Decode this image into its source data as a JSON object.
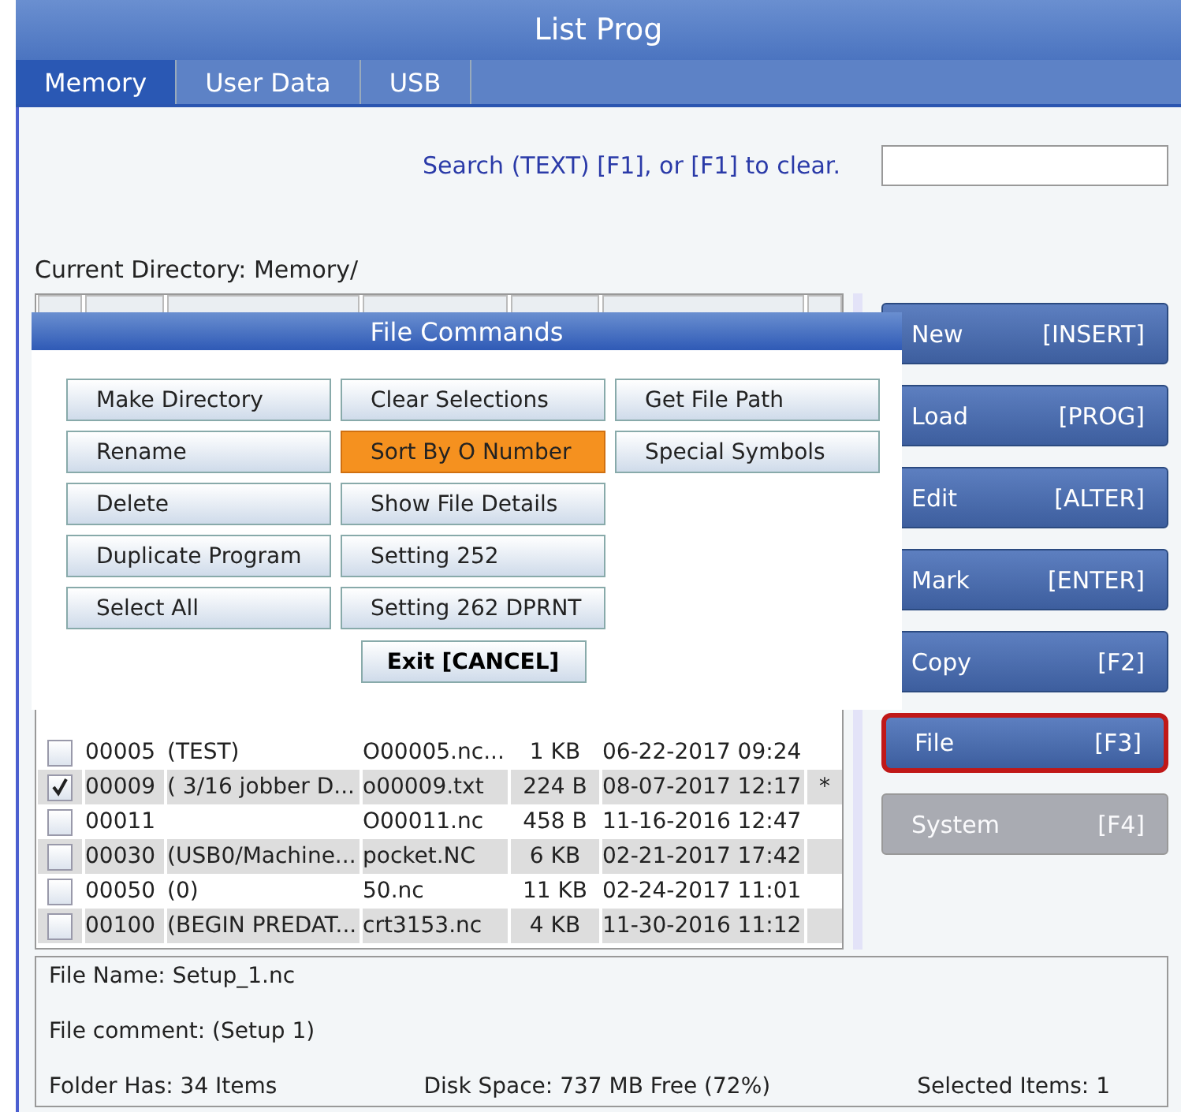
{
  "window": {
    "title": "List Prog"
  },
  "tabs": [
    {
      "label": "Memory",
      "selected": true
    },
    {
      "label": "User Data",
      "selected": false
    },
    {
      "label": "USB",
      "selected": false
    }
  ],
  "search": {
    "label": "Search (TEXT) [F1], or [F1] to clear."
  },
  "current_directory": "Current Directory: Memory/",
  "table": {
    "rows": [
      {
        "checked": false,
        "number": "00005",
        "comment": "(TEST)",
        "file_name": "O00005.nc...",
        "size": "1 KB",
        "last_modified": "06-22-2017 09:24"
      },
      {
        "checked": true,
        "number": "00009",
        "comment": "( 3/16 jobber D...",
        "file_name": "o00009.txt",
        "size": "224 B",
        "last_modified": "08-07-2017 12:17",
        "mark": "*"
      },
      {
        "checked": false,
        "number": "00011",
        "file_name": "O00011.nc",
        "size": "458 B",
        "last_modified": "11-16-2016 12:47"
      },
      {
        "checked": false,
        "number": "00030",
        "comment": "(USB0/Machine...",
        "file_name": "pocket.NC",
        "size": "6 KB",
        "last_modified": "02-21-2017 17:42"
      },
      {
        "checked": false,
        "number": "00050",
        "comment": "(0)",
        "file_name": "50.nc",
        "size": "11 KB",
        "last_modified": "02-24-2017 11:01"
      },
      {
        "checked": false,
        "number": "00100",
        "comment": "(BEGIN PREDAT...",
        "file_name": "crt3153.nc",
        "size": "4 KB",
        "last_modified": "11-30-2016 11:12"
      }
    ]
  },
  "side_buttons": [
    {
      "label": "New",
      "key": "[INSERT]",
      "selected": false,
      "disabled": false
    },
    {
      "label": "Load",
      "key": "[PROG]",
      "selected": false,
      "disabled": false
    },
    {
      "label": "Edit",
      "key": "[ALTER]",
      "selected": false,
      "disabled": false
    },
    {
      "label": "Mark",
      "key": "[ENTER]",
      "selected": false,
      "disabled": false
    },
    {
      "label": "Copy",
      "key": "[F2]",
      "selected": false,
      "disabled": false
    },
    {
      "label": "File",
      "key": "[F3]",
      "selected": true,
      "disabled": false
    },
    {
      "label": "System",
      "key": "[F4]",
      "selected": false,
      "disabled": true
    }
  ],
  "info": {
    "file_name": "File Name: Setup_1.nc",
    "file_comment": "File comment: (Setup 1)",
    "folder_count": "Folder Has: 34 Items",
    "disk_space": "Disk Space: 737 MB Free (72%)",
    "selected_items": "Selected Items: 1"
  },
  "dialog": {
    "title": "File Commands",
    "columns": [
      [
        {
          "label": "Make Directory",
          "selected": false
        },
        {
          "label": "Rename",
          "selected": false
        },
        {
          "label": "Delete",
          "selected": false
        },
        {
          "label": "Duplicate Program",
          "selected": false
        },
        {
          "label": "Select All",
          "selected": false
        }
      ],
      [
        {
          "label": "Clear Selections",
          "selected": false
        },
        {
          "label": "Sort By O Number",
          "selected": true
        },
        {
          "label": "Show File Details",
          "selected": false
        },
        {
          "label": "Setting 252",
          "selected": false
        },
        {
          "label": "Setting 262 DPRNT",
          "selected": false
        }
      ],
      [
        {
          "label": "Get File Path",
          "selected": false
        },
        {
          "label": "Special Symbols",
          "selected": false
        }
      ]
    ],
    "exit_button": "Exit  [CANCEL]"
  }
}
